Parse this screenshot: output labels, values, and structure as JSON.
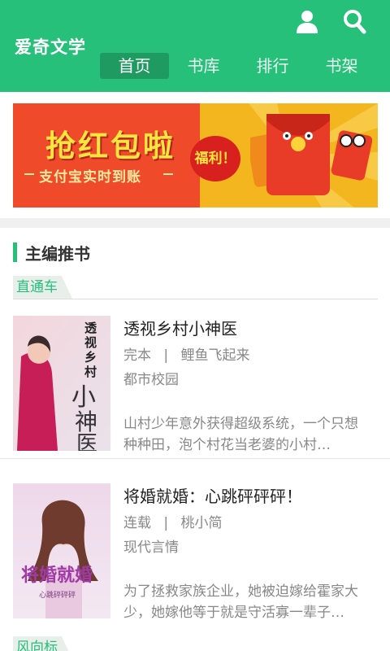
{
  "header": {
    "app_title": "爱奇文学",
    "tabs": [
      {
        "label": "首页",
        "active": true
      },
      {
        "label": "书库",
        "active": false
      },
      {
        "label": "排行",
        "active": false
      },
      {
        "label": "书架",
        "active": false
      }
    ],
    "colors": {
      "bar": "#27c07a",
      "active_tab": "#1f9b61"
    }
  },
  "banner": {
    "title": "抢红包啦",
    "subtitle": "支付宝实时到账",
    "badge": "福利！"
  },
  "section": {
    "title": "主编推书",
    "subtab_1": "直通车",
    "subtab_2": "风向标"
  },
  "books": [
    {
      "title": "透视乡村小神医",
      "status": "完本",
      "separator": "|",
      "author": "鲤鱼飞起来",
      "category": "都市校园",
      "description": "山村少年意外获得超级系统，一个只想种种田，泡个村花当老婆的小村…",
      "cover_text": "透视乡村小神医"
    },
    {
      "title": "将婚就婚：心跳砰砰砰！",
      "status": "连载",
      "separator": "|",
      "author": "桃小简",
      "category": "现代言情",
      "description": "为了拯救家族企业，她被迫嫁给霍家大少，她嫁他等于就是守活寡一辈子…",
      "cover_text": "将婚就婚"
    }
  ]
}
